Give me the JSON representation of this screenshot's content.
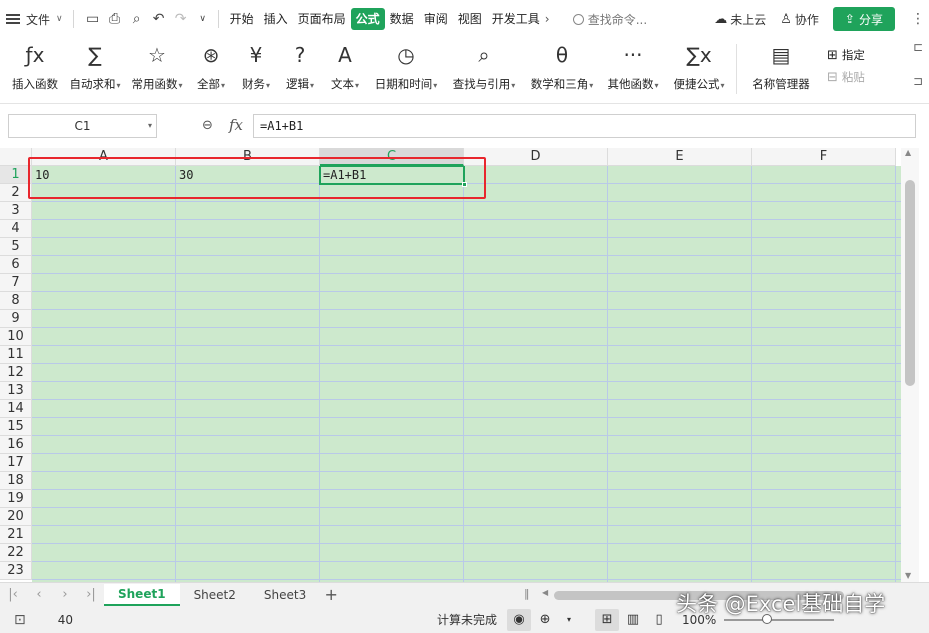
{
  "topbar": {
    "file_menu": "文件",
    "tabs": [
      "开始",
      "插入",
      "页面布局",
      "公式",
      "数据",
      "审阅",
      "视图",
      "开发工具"
    ],
    "active_tab": "公式",
    "search_placeholder": "查找命令...",
    "cloud_status": "未上云",
    "collaborate": "协作",
    "share": "分享"
  },
  "ribbon": {
    "groups": [
      {
        "label": "插入函数",
        "icon": "fx-icon",
        "glyph": "ƒx"
      },
      {
        "label": "自动求和",
        "icon": "sigma-icon",
        "glyph": "∑",
        "dropdown": true
      },
      {
        "label": "常用函数",
        "icon": "star-icon",
        "glyph": "☆",
        "dropdown": true
      },
      {
        "label": "全部",
        "icon": "all-functions-icon",
        "glyph": "⊛",
        "dropdown": true
      },
      {
        "label": "财务",
        "icon": "finance-icon",
        "glyph": "¥",
        "dropdown": true
      },
      {
        "label": "逻辑",
        "icon": "logic-icon",
        "glyph": "?",
        "dropdown": true
      },
      {
        "label": "文本",
        "icon": "text-icon",
        "glyph": "A",
        "dropdown": true
      },
      {
        "label": "日期和时间",
        "icon": "clock-icon",
        "glyph": "◷",
        "dropdown": true
      },
      {
        "label": "查找与引用",
        "icon": "lookup-icon",
        "glyph": "⌕",
        "dropdown": true
      },
      {
        "label": "数学和三角",
        "icon": "math-icon",
        "glyph": "θ",
        "dropdown": true
      },
      {
        "label": "其他函数",
        "icon": "more-functions-icon",
        "glyph": "···",
        "dropdown": true
      },
      {
        "label": "便捷公式",
        "icon": "quick-formula-icon",
        "glyph": "∑x",
        "dropdown": true
      },
      {
        "label": "名称管理器",
        "icon": "name-manager-icon",
        "glyph": "▤"
      }
    ],
    "side_items": [
      {
        "label": "指定",
        "icon": "define-name-icon",
        "glyph": "⊞",
        "disabled": false
      },
      {
        "label": "粘贴",
        "icon": "paste-name-icon",
        "glyph": "⊟",
        "disabled": true
      }
    ]
  },
  "formula_bar": {
    "name_box": "C1",
    "fx": "fx",
    "formula": "=A1+B1"
  },
  "sheet": {
    "columns": [
      "A",
      "B",
      "C",
      "D",
      "E",
      "F"
    ],
    "selected_column": "C",
    "rows": [
      "1",
      "2",
      "3",
      "4",
      "5",
      "6",
      "7",
      "8",
      "9",
      "10",
      "11",
      "12",
      "13",
      "14",
      "15",
      "16",
      "17",
      "18",
      "19",
      "20",
      "21",
      "22",
      "23"
    ],
    "selected_row": "1",
    "cells": {
      "A1": "10",
      "B1": "30",
      "C1": "=A1+B1"
    },
    "cell_fill": "#cde9cd",
    "highlight_color": "#e8262d",
    "accent": "#1fa35b"
  },
  "sheet_tabs": {
    "tabs": [
      "Sheet1",
      "Sheet2",
      "Sheet3"
    ],
    "active": "Sheet1",
    "add": "+"
  },
  "status": {
    "value": "40",
    "calc_status": "计算未完成",
    "zoom": "100%"
  },
  "watermark": "头条 @Excel基础自学"
}
